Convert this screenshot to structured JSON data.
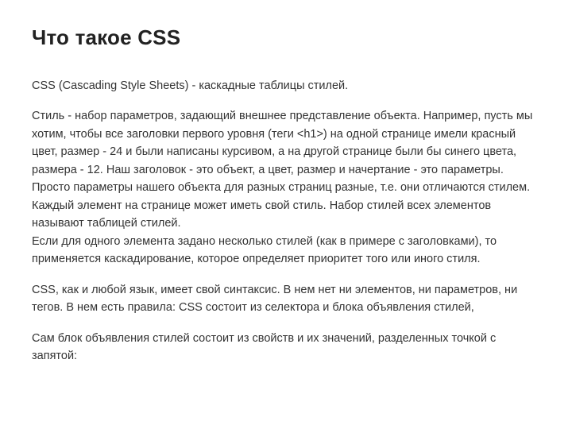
{
  "title": "Что такое CSS",
  "paragraphs": {
    "p1": "CSS (Cascading Style Sheets) - каскадные таблицы стилей.",
    "p2a": "Стиль - набор параметров, задающий внешнее представление объекта. Например, пусть мы хотим, чтобы все заголовки первого уровня (теги <h1>) на одной странице имели красный цвет, размер - 24 и были написаны курсивом, а на другой странице были бы синего цвета, размера - 12. Наш заголовок - это объект, а цвет, размер и начертание - это параметры. Просто параметры нашего объекта для разных страниц разные, т.е. они отличаются стилем.",
    "p2b": "Каждый элемент на странице может иметь свой стиль. Набор стилей всех элементов называют таблицей стилей.",
    "p2c": "Если для одного элемента задано несколько стилей (как в примере с заголовками), то применяется каскадирование, которое определяет приоритет того или иного стиля.",
    "p3": "CSS, как и любой язык, имеет свой синтаксис. В нем нет ни элементов, ни параметров, ни тегов. В нем есть правила: CSS состоит из селектора и блока объявления стилей,",
    "p4": "Сам блок объявления стилей состоит из свойств и их значений, разделенных точкой с запятой:"
  }
}
